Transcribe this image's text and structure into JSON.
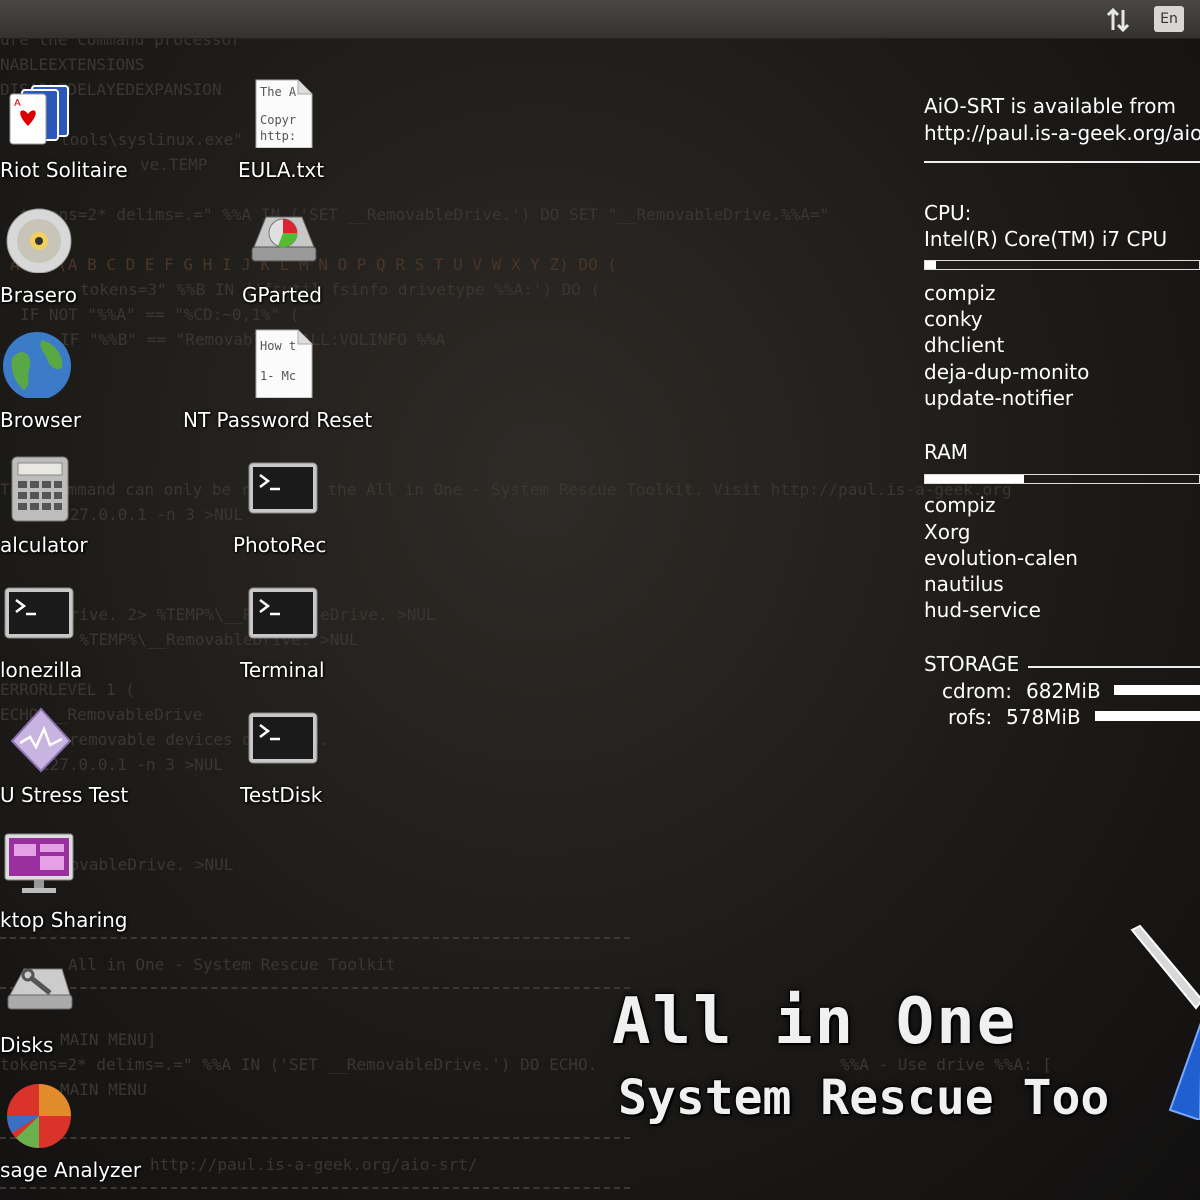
{
  "topbar": {
    "lang": "En"
  },
  "background_code": [
    "ure the command processor",
    "NABLEEXTENSIONS",
    "DISABLEDELAYEDEXPANSION",
    "tools\\syslinux.exe\"",
    "ve.TEMP",
    "tokens=2* delims=.=\" %%A IN ('SET __RemovableDrive.') DO SET \"__RemovableDrive.%%A=\"",
    "A IN (A B C D E F G H I J K L M N O P Q R S T U V W X Y Z) DO (",
    "tokens=3\" %%B IN ('fsutil fsinfo drivetype %%A:') DO (",
    "IF NOT \"%%A\" == \"%CD:~0,1%\" (",
    "IF \"%%B\" == \"Removable\" CALL:VOLINFO %%A",
    "This command can only be run from the All in One - System Rescue Toolkit.  Visit http://paul.is-a-geek.org",
    "127.0.0.1 -n 3 >NUL",
    "Drive. 2> %TEMP%\\__RemovableDrive. >NUL",
    "\" %TEMP%\\__RemovableDrive. >NUL",
    "ERRORLEVEL 1 (",
    "ECHO __RemovableDrive",
    "No removable devices detected.",
    "127.0.0.1 -n 3 >NUL",
    "movableDrive. >NUL",
    "All in One - System Rescue Toolkit",
    "MAIN MENU]",
    "tokens=2* delims=.=\" %%A IN ('SET __RemovableDrive.') DO ECHO.",
    "%%A - Use drive %%A: [",
    "MAIN MENU",
    "http://paul.is-a-geek.org/aio-srt/"
  ],
  "desktop_icons": [
    {
      "label": "Riot Solitaire"
    },
    {
      "label": "EULA.txt",
      "doc_lines": [
        "The A",
        "Copyr",
        "http:"
      ]
    },
    {
      "label": "Brasero"
    },
    {
      "label": "GParted"
    },
    {
      "label": "Browser"
    },
    {
      "label": "NT Password Reset",
      "doc_lines": [
        "How t",
        "1- Mc"
      ]
    },
    {
      "label": "alculator"
    },
    {
      "label": "PhotoRec"
    },
    {
      "label": "lonezilla"
    },
    {
      "label": "Terminal"
    },
    {
      "label": "U Stress Test"
    },
    {
      "label": "TestDisk"
    },
    {
      "label": "ktop Sharing"
    },
    {
      "label": "Disks"
    },
    {
      "label": "sage Analyzer"
    }
  ],
  "conky": {
    "header_line1": "AiO-SRT is available from",
    "header_line2": "http://paul.is-a-geek.org/aio",
    "cpu_label": "CPU:",
    "cpu_model": "Intel(R) Core(TM) i7 CPU",
    "cpu_usage_fraction": 0.04,
    "cpu_processes": [
      "compiz",
      "conky",
      "dhclient",
      "deja-dup-monito",
      "update-notifier"
    ],
    "ram_label": "RAM",
    "ram_usage_fraction": 0.36,
    "ram_processes": [
      "compiz",
      "Xorg",
      "evolution-calen",
      "nautilus",
      "hud-service"
    ],
    "storage_label": "STORAGE",
    "storage": [
      {
        "name": "cdrom:",
        "size": "682MiB"
      },
      {
        "name": "rofs:",
        "size": "578MiB"
      }
    ]
  },
  "brand": {
    "line1": "All in One",
    "line2": "System Rescue Too"
  }
}
